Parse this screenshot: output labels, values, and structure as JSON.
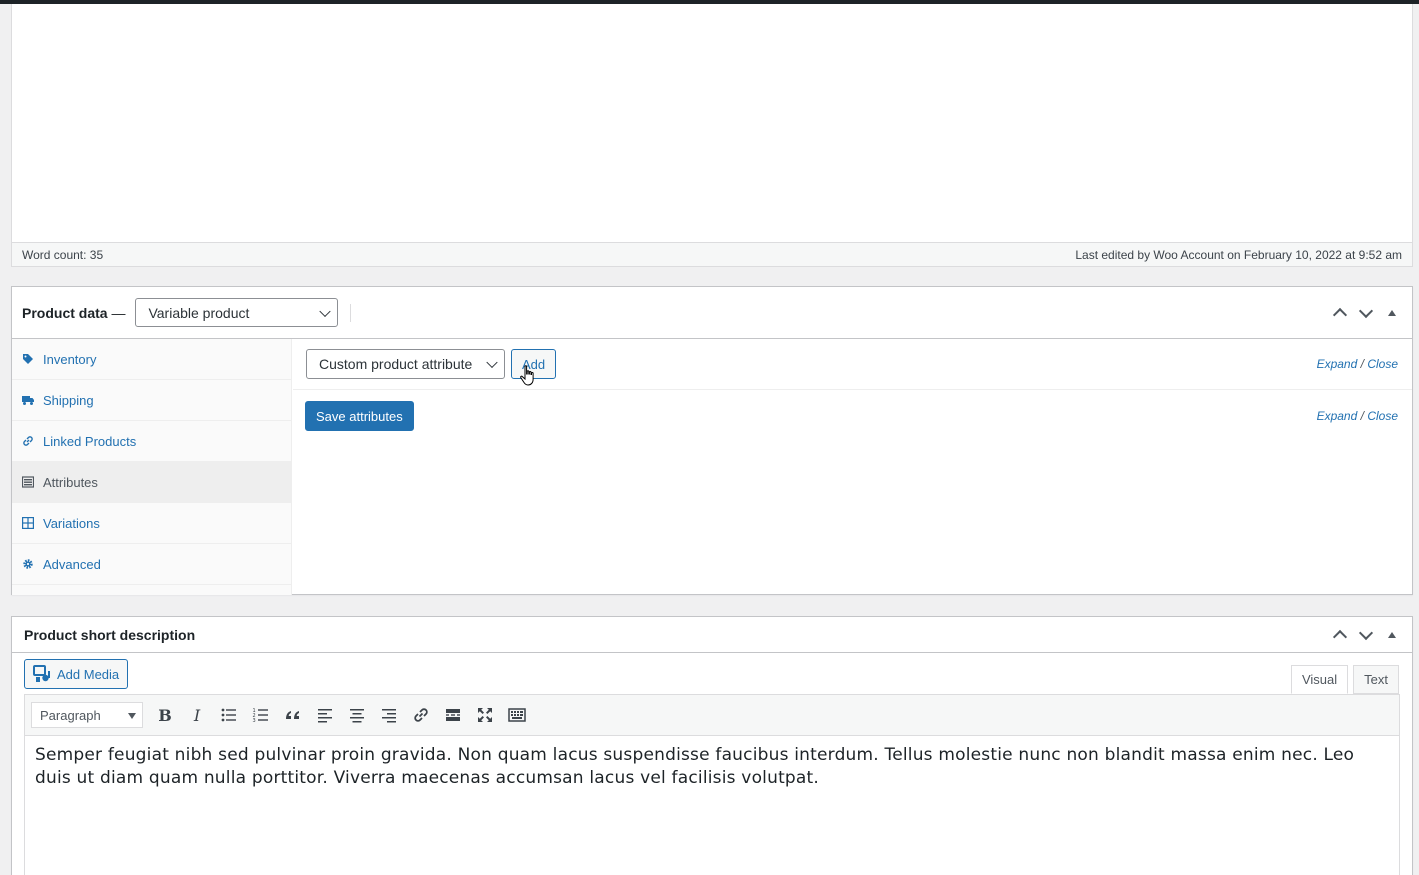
{
  "editor": {
    "word_count": "Word count: 35",
    "last_edited": "Last edited by Woo Account on February 10, 2022 at 9:52 am"
  },
  "product_data": {
    "title": "Product data",
    "dash": "—",
    "type_selected": "Variable product",
    "tabs": [
      {
        "label": "Inventory",
        "icon": "tag-icon"
      },
      {
        "label": "Shipping",
        "icon": "truck-icon"
      },
      {
        "label": "Linked Products",
        "icon": "link-icon"
      },
      {
        "label": "Attributes",
        "icon": "list-icon",
        "active": true
      },
      {
        "label": "Variations",
        "icon": "grid-icon"
      },
      {
        "label": "Advanced",
        "icon": "gear-icon"
      }
    ],
    "attributes": {
      "select_value": "Custom product attribute",
      "add_label": "Add",
      "expand": "Expand",
      "slash": "/",
      "close": "Close",
      "save_label": "Save attributes"
    }
  },
  "short_description": {
    "title": "Product short description",
    "add_media": "Add Media",
    "tab_visual": "Visual",
    "tab_text": "Text",
    "format": "Paragraph",
    "content": "Semper feugiat nibh sed pulvinar proin gravida. Non quam lacus suspendisse faucibus interdum. Tellus molestie nunc non blandit massa enim nec. Leo duis ut diam quam nulla porttitor. Viverra maecenas accumsan lacus vel facilisis volutpat."
  },
  "colors": {
    "accent": "#2271b1",
    "border": "#c3c4c7",
    "admin_dark": "#1d2327"
  }
}
